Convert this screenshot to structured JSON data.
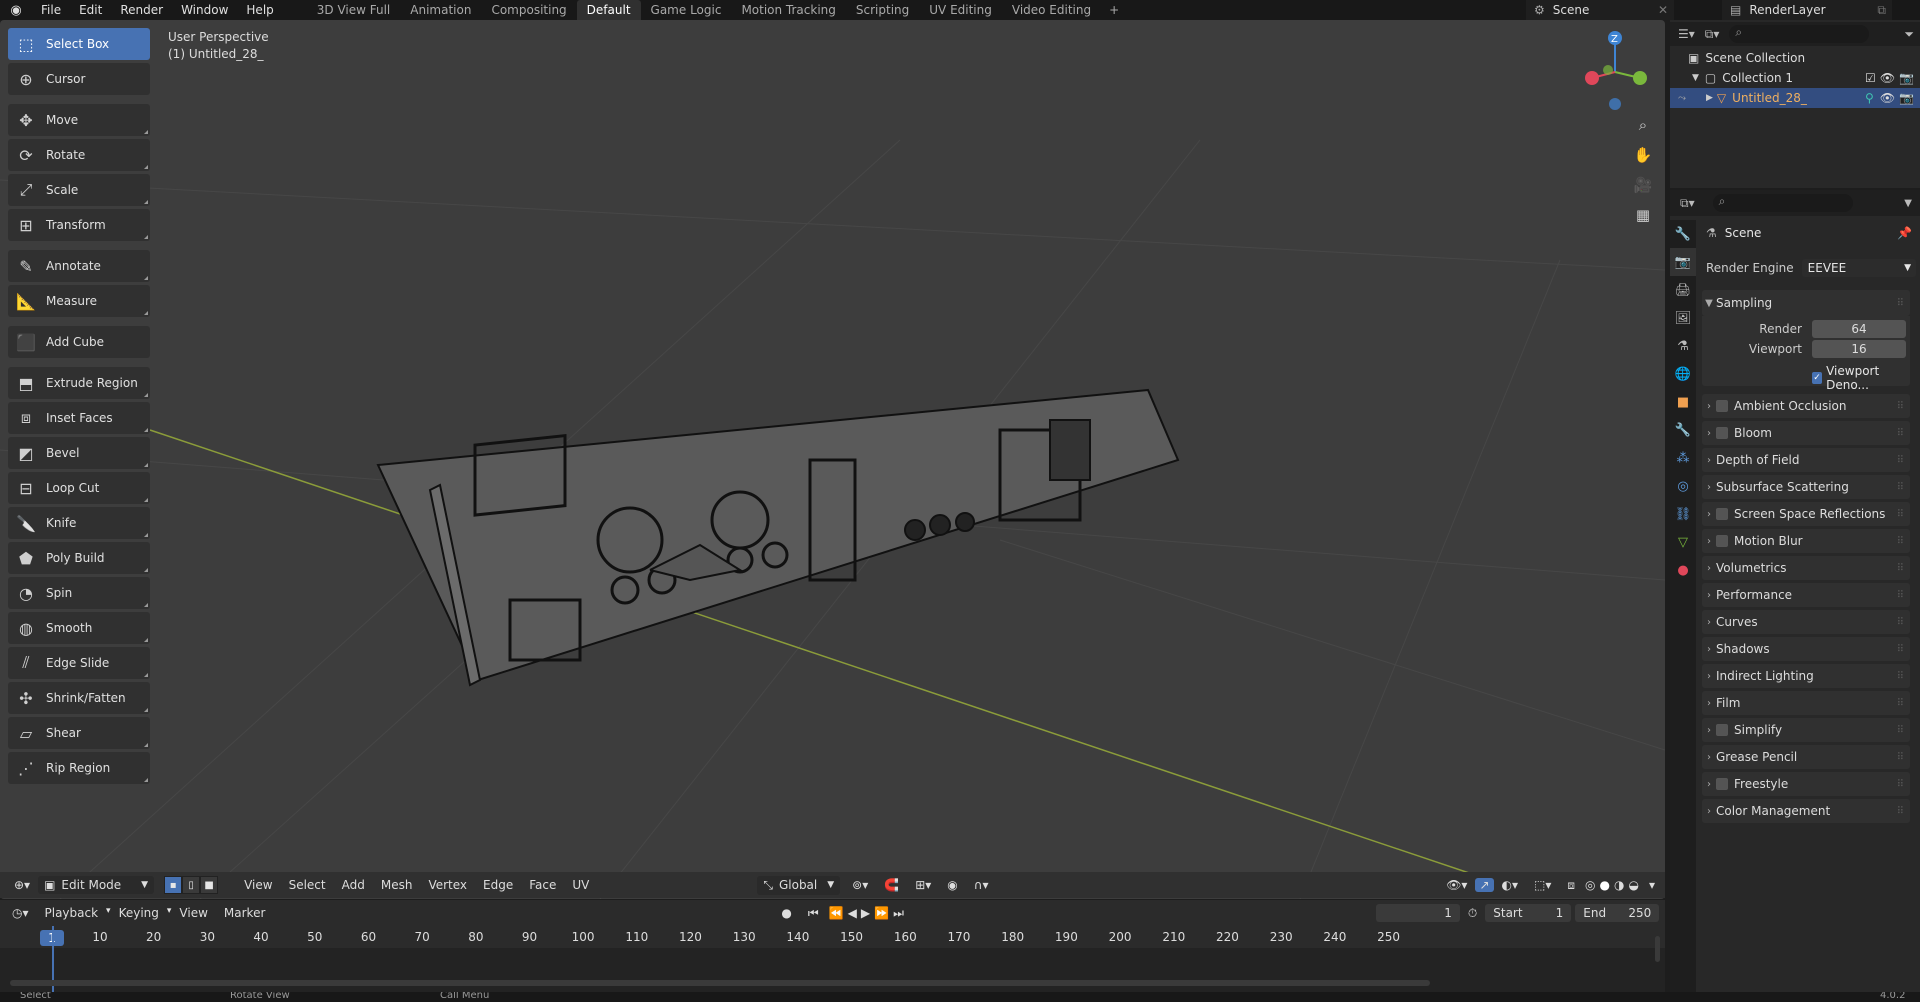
{
  "topbar": {
    "menus": [
      "File",
      "Edit",
      "Render",
      "Window",
      "Help"
    ],
    "workspaces": [
      "3D View Full",
      "Animation",
      "Compositing",
      "Default",
      "Game Logic",
      "Motion Tracking",
      "Scripting",
      "UV Editing",
      "Video Editing"
    ],
    "active_workspace": "Default",
    "scene": "Scene",
    "render_layer": "RenderLayer"
  },
  "viewport": {
    "perspective": "User Perspective",
    "object": "(1) Untitled_28_"
  },
  "toolbar": [
    {
      "label": "Select Box",
      "icon": "select-box-icon",
      "active": true
    },
    {
      "label": "Cursor",
      "icon": "cursor-icon"
    },
    {
      "label": "Move",
      "icon": "move-icon"
    },
    {
      "label": "Rotate",
      "icon": "rotate-icon"
    },
    {
      "label": "Scale",
      "icon": "scale-icon"
    },
    {
      "label": "Transform",
      "icon": "transform-icon"
    },
    {
      "label": "Annotate",
      "icon": "annotate-icon"
    },
    {
      "label": "Measure",
      "icon": "measure-icon"
    },
    {
      "label": "Add Cube",
      "icon": "add-cube-icon"
    },
    {
      "label": "Extrude Region",
      "icon": "extrude-icon"
    },
    {
      "label": "Inset Faces",
      "icon": "inset-icon"
    },
    {
      "label": "Bevel",
      "icon": "bevel-icon"
    },
    {
      "label": "Loop Cut",
      "icon": "loop-cut-icon"
    },
    {
      "label": "Knife",
      "icon": "knife-icon"
    },
    {
      "label": "Poly Build",
      "icon": "poly-build-icon"
    },
    {
      "label": "Spin",
      "icon": "spin-icon"
    },
    {
      "label": "Smooth",
      "icon": "smooth-icon"
    },
    {
      "label": "Edge Slide",
      "icon": "edge-slide-icon"
    },
    {
      "label": "Shrink/Fatten",
      "icon": "shrink-fatten-icon"
    },
    {
      "label": "Shear",
      "icon": "shear-icon"
    },
    {
      "label": "Rip Region",
      "icon": "rip-icon"
    }
  ],
  "vp_header": {
    "mode": "Edit Mode",
    "menus": [
      "View",
      "Select",
      "Add",
      "Mesh",
      "Vertex",
      "Edge",
      "Face",
      "UV"
    ],
    "orientation": "Global"
  },
  "timeline": {
    "menus": [
      "Playback",
      "Keying",
      "View",
      "Marker"
    ],
    "current_frame": "1",
    "start_label": "Start",
    "start": "1",
    "end_label": "End",
    "end": "250",
    "ticks": [
      "1",
      "10",
      "20",
      "30",
      "40",
      "50",
      "60",
      "70",
      "80",
      "90",
      "100",
      "110",
      "120",
      "130",
      "140",
      "150",
      "160",
      "170",
      "180",
      "190",
      "200",
      "210",
      "220",
      "230",
      "240",
      "250"
    ]
  },
  "status": {
    "items": [
      "Select",
      "Rotate View",
      "Call Menu"
    ],
    "version": "4.0.2"
  },
  "outliner": {
    "root": "Scene Collection",
    "collection": "Collection 1",
    "object": "Untitled_28_"
  },
  "properties": {
    "context": "Scene",
    "render_engine_label": "Render Engine",
    "render_engine": "EEVEE",
    "sampling": "Sampling",
    "render_label": "Render",
    "render_samples": "64",
    "viewport_label": "Viewport",
    "viewport_samples": "16",
    "viewport_denoise": "Viewport Deno...",
    "panels": [
      {
        "label": "Ambient Occlusion",
        "checkbox": true
      },
      {
        "label": "Bloom",
        "checkbox": true
      },
      {
        "label": "Depth of Field",
        "checkbox": false
      },
      {
        "label": "Subsurface Scattering",
        "checkbox": false
      },
      {
        "label": "Screen Space Reflections",
        "checkbox": true
      },
      {
        "label": "Motion Blur",
        "checkbox": true
      },
      {
        "label": "Volumetrics",
        "checkbox": false
      },
      {
        "label": "Performance",
        "checkbox": false
      },
      {
        "label": "Curves",
        "checkbox": false
      },
      {
        "label": "Shadows",
        "checkbox": false
      },
      {
        "label": "Indirect Lighting",
        "checkbox": false
      },
      {
        "label": "Film",
        "checkbox": false
      },
      {
        "label": "Simplify",
        "checkbox": true
      },
      {
        "label": "Grease Pencil",
        "checkbox": false
      },
      {
        "label": "Freestyle",
        "checkbox": true
      },
      {
        "label": "Color Management",
        "checkbox": false
      }
    ]
  },
  "colors": {
    "accent": "#4772b3",
    "x_axis": "#8b9c3a",
    "gizmo_x": "#e0475a",
    "gizmo_y": "#7ab83c",
    "gizmo_z": "#3f85d4"
  }
}
